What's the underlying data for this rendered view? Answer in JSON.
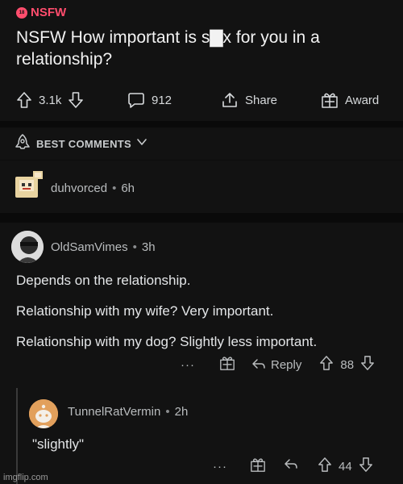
{
  "post": {
    "nsfw_badge": "18",
    "nsfw_label": "NSFW",
    "title": "NSFW How important is s▇x for you in a relationship?",
    "upvotes": "3.1k",
    "comments": "912",
    "share_label": "Share",
    "award_label": "Award"
  },
  "sort": {
    "label": "BEST COMMENTS"
  },
  "comments": [
    {
      "author": "duhvorced",
      "time": "6h"
    },
    {
      "author": "OldSamVimes",
      "time": "3h",
      "lines": [
        "Depends on the relationship.",
        "Relationship with my wife? Very important.",
        "Relationship with my dog? Slightly less important."
      ],
      "more": "···",
      "reply_label": "Reply",
      "score": "88"
    },
    {
      "author": "TunnelRatVermin",
      "time": "2h",
      "text": "\"slightly\"",
      "more": "···",
      "score": "44"
    }
  ],
  "watermark": "imgflip.com",
  "colors": {
    "nsfw": "#ff4d6d",
    "background": "#121212",
    "text": "#d7dadc"
  }
}
